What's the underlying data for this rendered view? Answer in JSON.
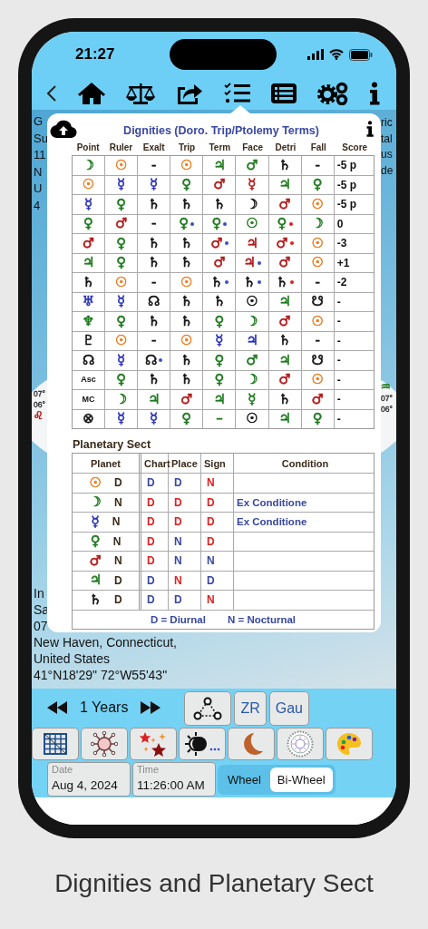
{
  "status_bar": {
    "time": "21:27"
  },
  "background": {
    "left_fragments": [
      "G",
      "Su",
      "11",
      "N",
      "U",
      "4"
    ],
    "right_fragments": [
      "ric",
      "tal",
      "us",
      "de"
    ],
    "wheel_left": {
      "degrees": [
        "07°",
        "06°"
      ],
      "sign": {
        "symbol": "♌",
        "color": "#c02020"
      }
    },
    "wheel_right": {
      "sign": {
        "symbol": "♒",
        "color": "#1f7a1f"
      },
      "degrees": [
        "07°",
        "06°"
      ]
    },
    "lower_fragments": [
      "In",
      "Sa",
      "07"
    ],
    "location": [
      "New Haven, Connecticut,",
      "United States",
      "41°N18'29\" 72°W55'43\""
    ]
  },
  "dignities": {
    "title": "Dignities (Doro. Trip/Ptolemy Terms)",
    "columns": [
      "Point",
      "Ruler",
      "Exalt",
      "Trip",
      "Term",
      "Face",
      "Detri",
      "Fall",
      "Score"
    ],
    "rows": [
      {
        "cells": [
          {
            "symbol": "☽",
            "color": "#1f7a1f"
          },
          {
            "symbol": "☉",
            "color": "#f07818"
          },
          {
            "symbol": "-",
            "color": "#111111"
          },
          {
            "symbol": "☉",
            "color": "#f07818"
          },
          {
            "symbol": "♃",
            "color": "#1f7a1f"
          },
          {
            "symbol": "♂",
            "color": "#1f7a1f"
          },
          {
            "symbol": "♄",
            "color": "#111111"
          },
          {
            "symbol": "-",
            "color": "#111111"
          }
        ],
        "score": "-5 p"
      },
      {
        "cells": [
          {
            "symbol": "☉",
            "color": "#f07818"
          },
          {
            "symbol": "☿",
            "color": "#2830b8"
          },
          {
            "symbol": "☿",
            "color": "#2830b8"
          },
          {
            "symbol": "♀",
            "color": "#1f7a1f"
          },
          {
            "symbol": "♂",
            "color": "#b01818"
          },
          {
            "symbol": "☿",
            "color": "#b01818"
          },
          {
            "symbol": "♃",
            "color": "#1f7a1f"
          },
          {
            "symbol": "♀",
            "color": "#1f7a1f"
          }
        ],
        "score": "-5 p"
      },
      {
        "cells": [
          {
            "symbol": "☿",
            "color": "#2830b8"
          },
          {
            "symbol": "♀",
            "color": "#1f7a1f"
          },
          {
            "symbol": "♄",
            "color": "#111111"
          },
          {
            "symbol": "♄",
            "color": "#111111"
          },
          {
            "symbol": "♄",
            "color": "#111111"
          },
          {
            "symbol": "☽",
            "color": "#111111"
          },
          {
            "symbol": "♂",
            "color": "#b01818"
          },
          {
            "symbol": "☉",
            "color": "#f07818"
          }
        ],
        "score": "-5 p"
      },
      {
        "cells": [
          {
            "symbol": "♀",
            "color": "#1f7a1f"
          },
          {
            "symbol": "♂",
            "color": "#b01818"
          },
          {
            "symbol": "-",
            "color": "#111111"
          },
          {
            "symbol": "♀",
            "color": "#1f7a1f",
            "dot": {
              "color": "#3a50c0"
            }
          },
          {
            "symbol": "♀",
            "color": "#1f7a1f",
            "dot": {
              "color": "#3a50c0"
            }
          },
          {
            "symbol": "☉",
            "color": "#1f7a1f"
          },
          {
            "symbol": "♀",
            "color": "#1f7a1f",
            "dot": {
              "color": "#e02020"
            }
          },
          {
            "symbol": "☽",
            "color": "#1f7a1f"
          }
        ],
        "score": "0"
      },
      {
        "cells": [
          {
            "symbol": "♂",
            "color": "#b01818"
          },
          {
            "symbol": "♀",
            "color": "#1f7a1f"
          },
          {
            "symbol": "♄",
            "color": "#111111"
          },
          {
            "symbol": "♄",
            "color": "#111111"
          },
          {
            "symbol": "♂",
            "color": "#b01818",
            "dot": {
              "color": "#3a50c0"
            }
          },
          {
            "symbol": "♃",
            "color": "#b01818"
          },
          {
            "symbol": "♂",
            "color": "#b01818",
            "dot": {
              "color": "#e02020"
            }
          },
          {
            "symbol": "☉",
            "color": "#f07818"
          }
        ],
        "score": "-3"
      },
      {
        "cells": [
          {
            "symbol": "♃",
            "color": "#1f7a1f"
          },
          {
            "symbol": "♀",
            "color": "#1f7a1f"
          },
          {
            "symbol": "♄",
            "color": "#111111"
          },
          {
            "symbol": "♄",
            "color": "#111111"
          },
          {
            "symbol": "♂",
            "color": "#b01818"
          },
          {
            "symbol": "♃",
            "color": "#b01818",
            "dot": {
              "color": "#3a50c0"
            }
          },
          {
            "symbol": "♂",
            "color": "#b01818"
          },
          {
            "symbol": "☉",
            "color": "#f07818"
          }
        ],
        "score": "+1"
      },
      {
        "cells": [
          {
            "symbol": "♄",
            "color": "#111111"
          },
          {
            "symbol": "☉",
            "color": "#f07818"
          },
          {
            "symbol": "-",
            "color": "#111111"
          },
          {
            "symbol": "☉",
            "color": "#f07818"
          },
          {
            "symbol": "♄",
            "color": "#111111",
            "dot": {
              "color": "#3a50c0"
            }
          },
          {
            "symbol": "♄",
            "color": "#111111",
            "dot": {
              "color": "#3a50c0"
            }
          },
          {
            "symbol": "♄",
            "color": "#111111",
            "dot": {
              "color": "#e02020"
            }
          },
          {
            "symbol": "-",
            "color": "#111111"
          }
        ],
        "score": "-2"
      },
      {
        "cells": [
          {
            "symbol": "♅",
            "color": "#2830b8"
          },
          {
            "symbol": "☿",
            "color": "#2830b8"
          },
          {
            "symbol": "☊",
            "color": "#111111"
          },
          {
            "symbol": "♄",
            "color": "#111111"
          },
          {
            "symbol": "♄",
            "color": "#111111"
          },
          {
            "symbol": "☉",
            "color": "#111111"
          },
          {
            "symbol": "♃",
            "color": "#1f7a1f"
          },
          {
            "symbol": "☋",
            "color": "#111111"
          }
        ],
        "score": "-"
      },
      {
        "cells": [
          {
            "symbol": "♆",
            "color": "#1f7a1f"
          },
          {
            "symbol": "♀",
            "color": "#1f7a1f"
          },
          {
            "symbol": "♄",
            "color": "#111111"
          },
          {
            "symbol": "♄",
            "color": "#111111"
          },
          {
            "symbol": "♀",
            "color": "#1f7a1f"
          },
          {
            "symbol": "☽",
            "color": "#1f7a1f"
          },
          {
            "symbol": "♂",
            "color": "#b01818"
          },
          {
            "symbol": "☉",
            "color": "#f07818"
          }
        ],
        "score": "-"
      },
      {
        "cells": [
          {
            "symbol": "♇",
            "color": "#111111"
          },
          {
            "symbol": "☉",
            "color": "#f07818"
          },
          {
            "symbol": "-",
            "color": "#111111"
          },
          {
            "symbol": "☉",
            "color": "#f07818"
          },
          {
            "symbol": "☿",
            "color": "#2830b8"
          },
          {
            "symbol": "♃",
            "color": "#2830b8"
          },
          {
            "symbol": "♄",
            "color": "#111111"
          },
          {
            "symbol": "-",
            "color": "#111111"
          }
        ],
        "score": "-"
      },
      {
        "cells": [
          {
            "symbol": "☊",
            "color": "#111111"
          },
          {
            "symbol": "☿",
            "color": "#2830b8"
          },
          {
            "symbol": "☊",
            "color": "#111111",
            "dot": {
              "color": "#3a50c0"
            }
          },
          {
            "symbol": "♄",
            "color": "#111111"
          },
          {
            "symbol": "♀",
            "color": "#1f7a1f"
          },
          {
            "symbol": "♂",
            "color": "#1f7a1f"
          },
          {
            "symbol": "♃",
            "color": "#1f7a1f"
          },
          {
            "symbol": "☋",
            "color": "#111111"
          }
        ],
        "score": "-"
      },
      {
        "cells": [
          {
            "symbol": "Asc",
            "color": "#111111"
          },
          {
            "symbol": "♀",
            "color": "#1f7a1f"
          },
          {
            "symbol": "♄",
            "color": "#111111"
          },
          {
            "symbol": "♄",
            "color": "#111111"
          },
          {
            "symbol": "♀",
            "color": "#1f7a1f"
          },
          {
            "symbol": "☽",
            "color": "#1f7a1f"
          },
          {
            "symbol": "♂",
            "color": "#b01818"
          },
          {
            "symbol": "☉",
            "color": "#f07818"
          }
        ],
        "score": "-"
      },
      {
        "cells": [
          {
            "symbol": "MC",
            "color": "#111111"
          },
          {
            "symbol": "☽",
            "color": "#1f7a1f"
          },
          {
            "symbol": "♃",
            "color": "#1f7a1f"
          },
          {
            "symbol": "♂",
            "color": "#b01818"
          },
          {
            "symbol": "♃",
            "color": "#1f7a1f"
          },
          {
            "symbol": "☿",
            "color": "#1f7a1f"
          },
          {
            "symbol": "♄",
            "color": "#111111"
          },
          {
            "symbol": "♂",
            "color": "#b01818"
          }
        ],
        "score": "-"
      },
      {
        "cells": [
          {
            "symbol": "⊗",
            "color": "#111111"
          },
          {
            "symbol": "☿",
            "color": "#2830b8"
          },
          {
            "symbol": "☿",
            "color": "#2830b8"
          },
          {
            "symbol": "♀",
            "color": "#1f7a1f"
          },
          {
            "symbol": "–",
            "color": "#1f7a1f"
          },
          {
            "symbol": "☉",
            "color": "#111111"
          },
          {
            "symbol": "♃",
            "color": "#1f7a1f"
          },
          {
            "symbol": "♀",
            "color": "#1f7a1f"
          }
        ],
        "score": "-"
      }
    ]
  },
  "sect": {
    "title": "Planetary Sect",
    "columns": [
      "Planet",
      "Chart",
      "Place",
      "Sign",
      "Condition"
    ],
    "rows": [
      {
        "symbol": "☉",
        "color": "#f07818",
        "sect": "D",
        "values": [
          {
            "text": "D",
            "color": "#3848a0"
          },
          {
            "text": "D",
            "color": "#3848a0"
          },
          {
            "text": "N",
            "color": "#e02020"
          }
        ]
      },
      {
        "symbol": "☽",
        "color": "#1f7a1f",
        "sect": "N",
        "values": [
          {
            "text": "D",
            "color": "#e02020"
          },
          {
            "text": "D",
            "color": "#e02020"
          },
          {
            "text": "D",
            "color": "#e02020"
          }
        ],
        "condition": "Ex Conditione"
      },
      {
        "symbol": "☿",
        "color": "#2830b8",
        "sect": "N",
        "values": [
          {
            "text": "D",
            "color": "#e02020"
          },
          {
            "text": "D",
            "color": "#e02020"
          },
          {
            "text": "D",
            "color": "#e02020"
          }
        ],
        "condition": "Ex Conditione"
      },
      {
        "symbol": "♀",
        "color": "#1f7a1f",
        "sect": "N",
        "values": [
          {
            "text": "D",
            "color": "#e02020"
          },
          {
            "text": "N",
            "color": "#3848a0"
          },
          {
            "text": "D",
            "color": "#e02020"
          }
        ]
      },
      {
        "symbol": "♂",
        "color": "#b01818",
        "sect": "N",
        "values": [
          {
            "text": "D",
            "color": "#e02020"
          },
          {
            "text": "N",
            "color": "#3848a0"
          },
          {
            "text": "N",
            "color": "#3848a0"
          }
        ]
      },
      {
        "symbol": "♃",
        "color": "#1f7a1f",
        "sect": "D",
        "values": [
          {
            "text": "D",
            "color": "#3848a0"
          },
          {
            "text": "N",
            "color": "#e02020"
          },
          {
            "text": "D",
            "color": "#3848a0"
          }
        ]
      },
      {
        "symbol": "♄",
        "color": "#111111",
        "sect": "D",
        "values": [
          {
            "text": "D",
            "color": "#3848a0"
          },
          {
            "text": "D",
            "color": "#3848a0"
          },
          {
            "text": "N",
            "color": "#e02020"
          }
        ]
      }
    ],
    "legend": [
      "D = Diurnal",
      "N = Nocturnal"
    ]
  },
  "period": {
    "label": "1 Years"
  },
  "chart_buttons": [
    "ZR",
    "Gau"
  ],
  "date": {
    "label": "Date",
    "value": "Aug 4, 2024"
  },
  "time": {
    "label": "Time",
    "value": "11:26:00 AM"
  },
  "view_tabs": [
    {
      "label": "Wheel",
      "selected": false
    },
    {
      "label": "Bi-Wheel",
      "selected": true
    }
  ],
  "caption": "Dignities and Planetary Sect"
}
